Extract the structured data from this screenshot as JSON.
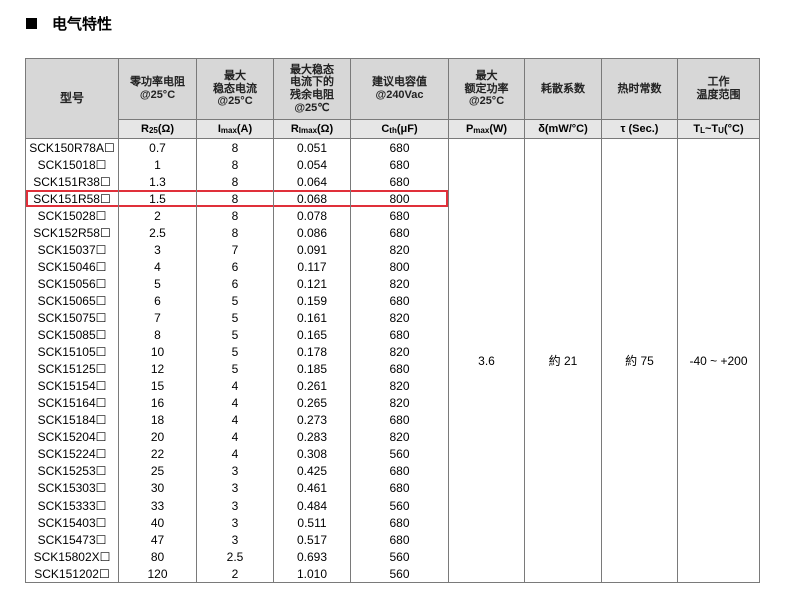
{
  "section": {
    "title": "电气特性"
  },
  "headers": {
    "model": "型号",
    "col1": "零功率电阻\n@25°C",
    "col2": "最大\n稳态电流\n@25°C",
    "col3": "最大稳态\n电流下的\n残余电阻\n@25℃",
    "col4": "建议电容值\n@240Vac",
    "col5": "最大\n额定功率\n@25°C",
    "col6": "耗散系数",
    "col7": "热时常数",
    "col8": "工作\n温度范围"
  },
  "units": {
    "col1": "R25(Ω)",
    "col2": "Imax(A)",
    "col3": "Rimax(Ω)",
    "col4": "Cth(μF)",
    "col5": "Pmax(W)",
    "col6": "δ(mW/°C)",
    "col7": "τ (Sec.)",
    "col8": "TL~TU(°C)"
  },
  "merged": {
    "power": "3.6",
    "dissipation": "約 21",
    "time_constant": "約 75",
    "temp_range": "-40 ~ +200"
  },
  "highlight_row_index": 3,
  "rows": [
    {
      "model": "SCK150R78A☐",
      "r25": "0.7",
      "imax": "8",
      "rimax": "0.051",
      "cth": "680"
    },
    {
      "model": "SCK15018☐",
      "r25": "1",
      "imax": "8",
      "rimax": "0.054",
      "cth": "680"
    },
    {
      "model": "SCK151R38☐",
      "r25": "1.3",
      "imax": "8",
      "rimax": "0.064",
      "cth": "680"
    },
    {
      "model": "SCK151R58☐",
      "r25": "1.5",
      "imax": "8",
      "rimax": "0.068",
      "cth": "800"
    },
    {
      "model": "SCK15028☐",
      "r25": "2",
      "imax": "8",
      "rimax": "0.078",
      "cth": "680"
    },
    {
      "model": "SCK152R58☐",
      "r25": "2.5",
      "imax": "8",
      "rimax": "0.086",
      "cth": "680"
    },
    {
      "model": "SCK15037☐",
      "r25": "3",
      "imax": "7",
      "rimax": "0.091",
      "cth": "820"
    },
    {
      "model": "SCK15046☐",
      "r25": "4",
      "imax": "6",
      "rimax": "0.117",
      "cth": "800"
    },
    {
      "model": "SCK15056☐",
      "r25": "5",
      "imax": "6",
      "rimax": "0.121",
      "cth": "820"
    },
    {
      "model": "SCK15065☐",
      "r25": "6",
      "imax": "5",
      "rimax": "0.159",
      "cth": "680"
    },
    {
      "model": "SCK15075☐",
      "r25": "7",
      "imax": "5",
      "rimax": "0.161",
      "cth": "820"
    },
    {
      "model": "SCK15085☐",
      "r25": "8",
      "imax": "5",
      "rimax": "0.165",
      "cth": "680"
    },
    {
      "model": "SCK15105☐",
      "r25": "10",
      "imax": "5",
      "rimax": "0.178",
      "cth": "820"
    },
    {
      "model": "SCK15125☐",
      "r25": "12",
      "imax": "5",
      "rimax": "0.185",
      "cth": "680"
    },
    {
      "model": "SCK15154☐",
      "r25": "15",
      "imax": "4",
      "rimax": "0.261",
      "cth": "820"
    },
    {
      "model": "SCK15164☐",
      "r25": "16",
      "imax": "4",
      "rimax": "0.265",
      "cth": "820"
    },
    {
      "model": "SCK15184☐",
      "r25": "18",
      "imax": "4",
      "rimax": "0.273",
      "cth": "680"
    },
    {
      "model": "SCK15204☐",
      "r25": "20",
      "imax": "4",
      "rimax": "0.283",
      "cth": "820"
    },
    {
      "model": "SCK15224☐",
      "r25": "22",
      "imax": "4",
      "rimax": "0.308",
      "cth": "560"
    },
    {
      "model": "SCK15253☐",
      "r25": "25",
      "imax": "3",
      "rimax": "0.425",
      "cth": "680"
    },
    {
      "model": "SCK15303☐",
      "r25": "30",
      "imax": "3",
      "rimax": "0.461",
      "cth": "680"
    },
    {
      "model": "SCK15333☐",
      "r25": "33",
      "imax": "3",
      "rimax": "0.484",
      "cth": "560"
    },
    {
      "model": "SCK15403☐",
      "r25": "40",
      "imax": "3",
      "rimax": "0.511",
      "cth": "680"
    },
    {
      "model": "SCK15473☐",
      "r25": "47",
      "imax": "3",
      "rimax": "0.517",
      "cth": "680"
    },
    {
      "model": "SCK15802X☐",
      "r25": "80",
      "imax": "2.5",
      "rimax": "0.693",
      "cth": "560"
    },
    {
      "model": "SCK151202☐",
      "r25": "120",
      "imax": "2",
      "rimax": "1.010",
      "cth": "560"
    }
  ]
}
